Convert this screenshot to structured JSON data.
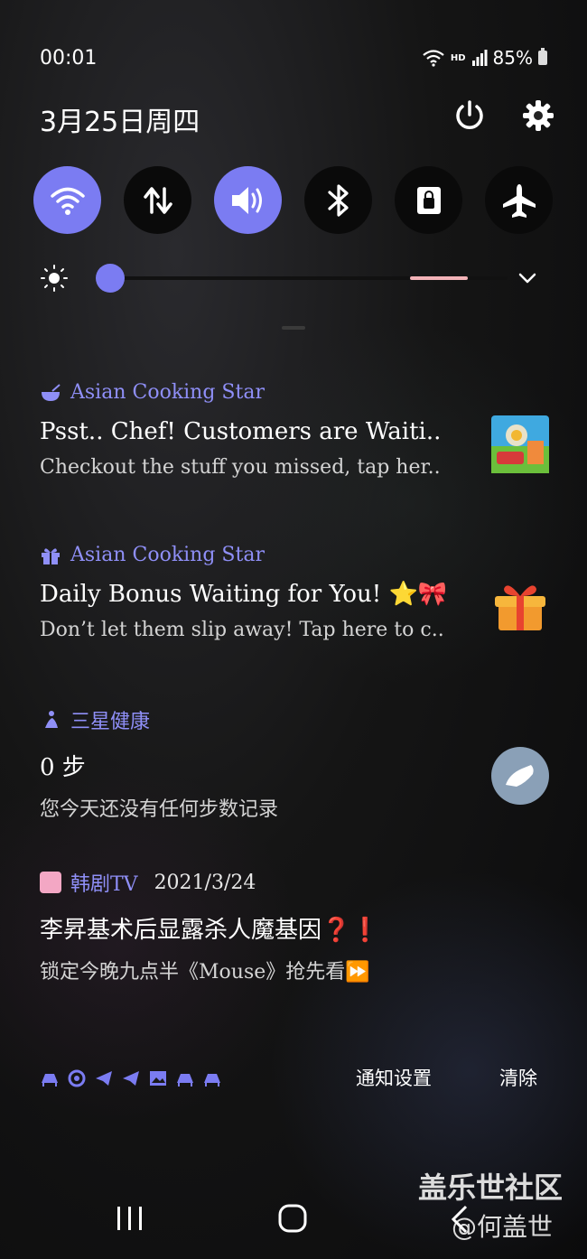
{
  "status_bar": {
    "time": "00:01",
    "network": "HD",
    "battery": "85%"
  },
  "header": {
    "date": "3月25日周四"
  },
  "quick_settings": [
    {
      "name": "wifi",
      "on": true
    },
    {
      "name": "mobile-data",
      "on": false
    },
    {
      "name": "sound",
      "on": true
    },
    {
      "name": "bluetooth",
      "on": false
    },
    {
      "name": "lock",
      "on": false
    },
    {
      "name": "airplane",
      "on": false
    }
  ],
  "brightness": {
    "level": 0.02
  },
  "notifications": [
    {
      "app": "Asian Cooking Star",
      "title": "Psst.. Chef! Customers are Waiti..",
      "body": "Checkout the stuff you missed, tap her.."
    },
    {
      "app": "Asian Cooking Star",
      "title": "Daily Bonus Waiting for You! ⭐🎀",
      "body": "Don’t let them slip away! Tap here to c.."
    },
    {
      "app": "三星健康",
      "title": "0 步",
      "body": "您今天还没有任何步数记录"
    },
    {
      "app": "韩剧TV",
      "date": "2021/3/24",
      "title": "李昇基术后显露杀人魔基因❓❗",
      "body": "锁定今晚九点半《Mouse》抢先看⏩"
    }
  ],
  "bottom": {
    "notification_settings": "通知设置",
    "clear": "清除"
  },
  "watermark": {
    "line1": "盖乐世社区",
    "line2": "@何盖世"
  },
  "colors": {
    "accent": "#7b7cf2",
    "tile_off": "#0a0a0a"
  }
}
